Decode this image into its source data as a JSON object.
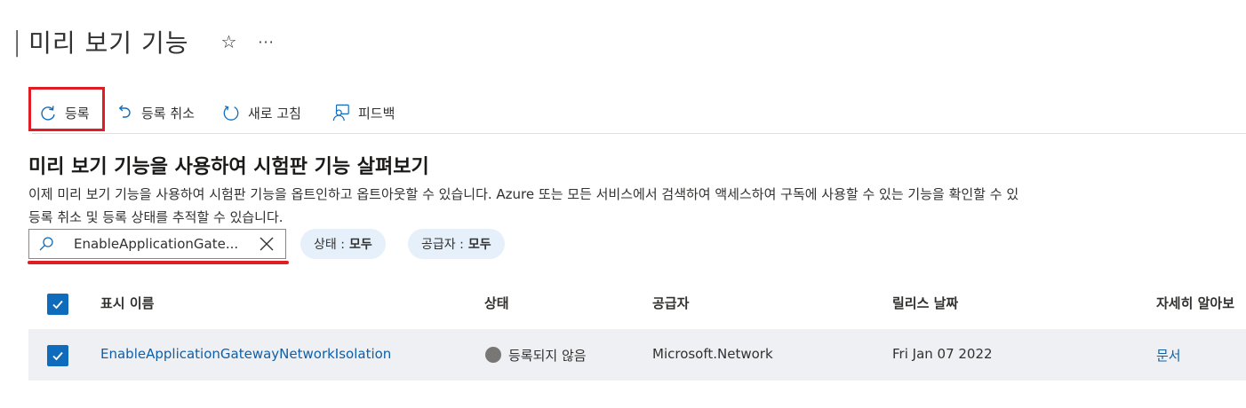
{
  "header": {
    "separator": "|",
    "title": "미리 보기 기능",
    "star_glyph": "☆",
    "more_glyph": "···"
  },
  "toolbar": {
    "items": [
      {
        "label": "등록",
        "icon": "register-redo-icon"
      },
      {
        "label": "등록 취소",
        "icon": "unregister-undo-icon"
      },
      {
        "label": "새로 고침",
        "icon": "refresh-icon"
      },
      {
        "label": "피드백",
        "icon": "feedback-person-icon"
      }
    ]
  },
  "main": {
    "heading": "미리 보기 기능을 사용하여 시험판 기능 살펴보기",
    "description_line1": "이제 미리 보기 기능을 사용하여 시험판 기능을 옵트인하고 옵트아웃할 수 있습니다. Azure 또는 모든 서비스에서 검색하여 액세스하여 구독에 사용할 수 있는 기능을 확인할 수 있",
    "description_line2": "등록 취소 및 등록 상태를 추적할 수 있습니다."
  },
  "filters": {
    "search_value": "EnableApplicationGate...",
    "status_label": "상태 :",
    "status_value": "모두",
    "publisher_label": "공급자 :",
    "publisher_value": "모두"
  },
  "table": {
    "columns": [
      "표시 이름",
      "상태",
      "공급자",
      "릴리스 날짜",
      "자세히 알아보"
    ],
    "rows": [
      {
        "name": "EnableApplicationGatewayNetworkIsolation",
        "status": "등록되지 않음",
        "provider": "Microsoft.Network",
        "release_date": "Fri Jan 07 2022",
        "learn_more": "문서",
        "selected": true
      }
    ]
  },
  "colors": {
    "accent": "#0f6cbd",
    "highlight": "#e01d24",
    "pill_bg": "#e6f0fa",
    "row_selected_bg": "#eef0f3"
  }
}
